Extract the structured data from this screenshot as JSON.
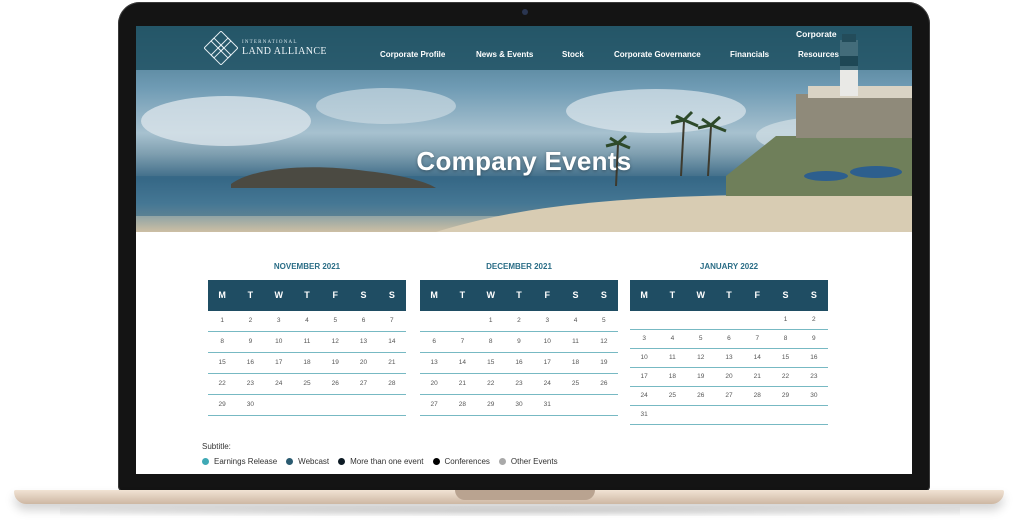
{
  "nav": {
    "logo_top": "INTERNATIONAL",
    "logo_main": "LAND ALLIANCE",
    "corporate_label": "Corporate",
    "items": [
      {
        "label": "Corporate Profile"
      },
      {
        "label": "News & Events"
      },
      {
        "label": "Stock"
      },
      {
        "label": "Corporate Governance"
      },
      {
        "label": "Financials"
      },
      {
        "label": "Resources"
      }
    ]
  },
  "hero": {
    "title": "Company Events"
  },
  "weekdays": [
    "M",
    "T",
    "W",
    "T",
    "F",
    "S",
    "S"
  ],
  "calendars": [
    {
      "title": "NOVEMBER 2021",
      "rows": [
        [
          "1",
          "2",
          "3",
          "4",
          "5",
          "6",
          "7"
        ],
        [
          "8",
          "9",
          "10",
          "11",
          "12",
          "13",
          "14"
        ],
        [
          "15",
          "16",
          "17",
          "18",
          "19",
          "20",
          "21"
        ],
        [
          "22",
          "23",
          "24",
          "25",
          "26",
          "27",
          "28"
        ],
        [
          "29",
          "30",
          "",
          "",
          "",
          "",
          ""
        ]
      ]
    },
    {
      "title": "DECEMBER 2021",
      "rows": [
        [
          "",
          "",
          "1",
          "2",
          "3",
          "4",
          "5"
        ],
        [
          "6",
          "7",
          "8",
          "9",
          "10",
          "11",
          "12"
        ],
        [
          "13",
          "14",
          "15",
          "16",
          "17",
          "18",
          "19"
        ],
        [
          "20",
          "21",
          "22",
          "23",
          "24",
          "25",
          "26"
        ],
        [
          "27",
          "28",
          "29",
          "30",
          "31",
          "",
          ""
        ]
      ]
    },
    {
      "title": "JANUARY 2022",
      "rows": [
        [
          "",
          "",
          "",
          "",
          "",
          "1",
          "2"
        ],
        [
          "3",
          "4",
          "5",
          "6",
          "7",
          "8",
          "9"
        ],
        [
          "10",
          "11",
          "12",
          "13",
          "14",
          "15",
          "16"
        ],
        [
          "17",
          "18",
          "19",
          "20",
          "21",
          "22",
          "23"
        ],
        [
          "24",
          "25",
          "26",
          "27",
          "28",
          "29",
          "30"
        ],
        [
          "31",
          "",
          "",
          "",
          "",
          "",
          ""
        ]
      ]
    }
  ],
  "legend": {
    "title": "Subtitle:",
    "items": [
      {
        "label": "Earnings Release",
        "color": "#3fa9b5"
      },
      {
        "label": "Webcast",
        "color": "#2a5a70"
      },
      {
        "label": "More than one event",
        "color": "#0d1a24"
      },
      {
        "label": "Conferences",
        "color": "#000000"
      },
      {
        "label": "Other Events",
        "color": "#a9a9a9"
      }
    ]
  },
  "colors": {
    "nav_bg": "#1f5062",
    "calendar_header": "#1f4d63",
    "month_title": "#2a6d86",
    "row_divider": "#77b9c3"
  }
}
